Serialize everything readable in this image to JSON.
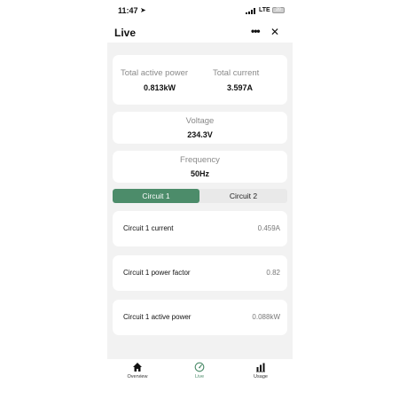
{
  "status_bar": {
    "time": "11:47",
    "network": "LTE",
    "battery": "20"
  },
  "header": {
    "title": "Live",
    "more_icon": "more-horizontal-icon",
    "close_icon": "close-icon"
  },
  "summary": {
    "total_active_power": {
      "label": "Total active power",
      "value": "0.813kW"
    },
    "total_current": {
      "label": "Total current",
      "value": "3.597A"
    },
    "voltage": {
      "label": "Voltage",
      "value": "234.3V"
    },
    "frequency": {
      "label": "Frequency",
      "value": "50Hz"
    }
  },
  "tabs": [
    {
      "label": "Circuit 1",
      "selected": true
    },
    {
      "label": "Circuit 2",
      "selected": false
    }
  ],
  "circuit_rows": [
    {
      "label": "Circuit 1 current",
      "value": "0.459A"
    },
    {
      "label": "Circuit 1 power factor",
      "value": "0.82"
    },
    {
      "label": "Circuit 1 active power",
      "value": "0.088kW"
    }
  ],
  "nav": [
    {
      "label": "Overview",
      "icon": "home-icon",
      "active": false
    },
    {
      "label": "Live",
      "icon": "gauge-icon",
      "active": true
    },
    {
      "label": "Usage",
      "icon": "bar-chart-icon",
      "active": false
    }
  ],
  "colors": {
    "accent": "#4c8c6a",
    "background": "#f2f2f2",
    "card": "#ffffff"
  }
}
